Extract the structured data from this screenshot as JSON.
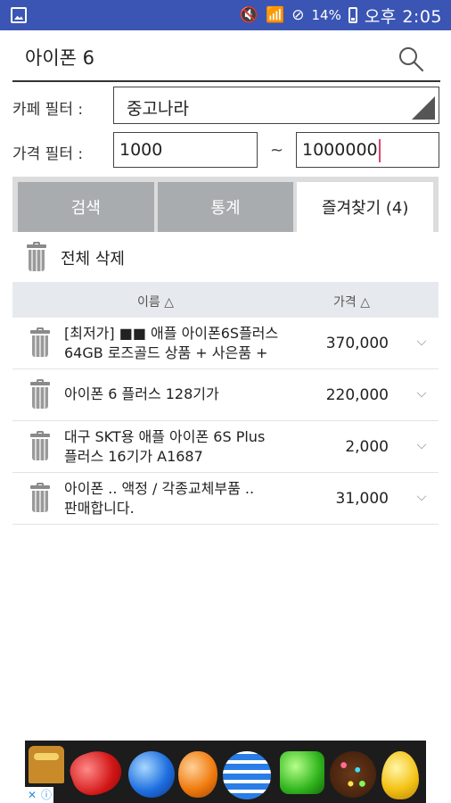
{
  "status_bar": {
    "battery_percent": "14%",
    "clock": "오후 2:05"
  },
  "search": {
    "query": "아이폰 6"
  },
  "filters": {
    "cafe_label": "카페 필터 :",
    "cafe_value": "중고나라",
    "price_label": "가격 필터 :",
    "price_min": "1000",
    "price_separator": "~",
    "price_max": "1000000"
  },
  "tabs": [
    {
      "label": "검색",
      "active": false
    },
    {
      "label": "통계",
      "active": false
    },
    {
      "label": "즐겨찾기 (4)",
      "active": true
    }
  ],
  "delete_all_label": "전체 삭제",
  "table": {
    "header_name": "이름 △",
    "header_price": "가격 △",
    "rows": [
      {
        "title_line1": "[최저가] ■■ 애플 아이폰6S플러스",
        "title_line2": "64GB 로즈골드 상품 + 사은품 +",
        "price": "370,000"
      },
      {
        "title_line1": "아이폰 6 플러스 128기가",
        "title_line2": "",
        "price": "220,000"
      },
      {
        "title_line1": "대구 SKT용 애플 아이폰 6S Plus",
        "title_line2": "플러스 16기가 A1687",
        "price": "2,000"
      },
      {
        "title_line1": "아이폰 .. 액정 / 각종교체부품 ..",
        "title_line2": "판매합니다.",
        "price": "31,000"
      }
    ]
  },
  "colors": {
    "status_bar": "#3a55b4",
    "tab_inactive": "#a9acae",
    "caret": "#e0426b"
  }
}
